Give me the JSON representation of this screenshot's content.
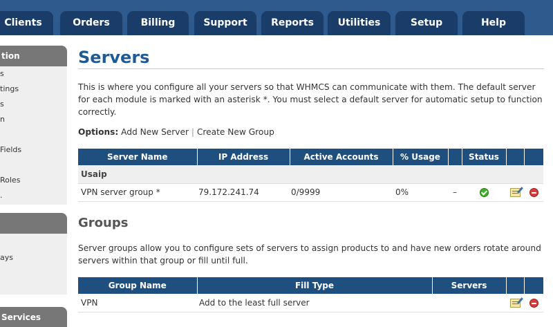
{
  "nav": {
    "tabs": [
      "Clients",
      "Orders",
      "Billing",
      "Support",
      "Reports",
      "Utilities",
      "Setup",
      "Help"
    ]
  },
  "sidebar": {
    "header1": "tion",
    "items1": [
      "s",
      "tings",
      "s",
      "n",
      "Fields",
      "Roles",
      "."
    ],
    "items2": [
      "ays"
    ],
    "header3": "Services"
  },
  "main": {
    "title": "Servers",
    "description": "This is where you configure all your servers so that WHMCS can communicate with them. The default server for each module is marked with an asterisk *. You must select a default server for automatic setup to function correctly.",
    "options_label": "Options:",
    "options_add": "Add New Server",
    "options_sep": "|",
    "options_group": "Create New Group"
  },
  "servers_table": {
    "headers": [
      "Server Name",
      "IP Address",
      "Active Accounts",
      "% Usage",
      "",
      "Status",
      "",
      ""
    ],
    "group_name": "Usaip",
    "row": {
      "name": "VPN server group *",
      "ip": "79.172.241.74",
      "accounts": "0/9999",
      "usage": "0%",
      "dash": "–"
    }
  },
  "groups": {
    "title": "Groups",
    "description": "Server groups allow you to configure sets of servers to assign products to and have new orders rotate around servers within that group or fill until full.",
    "headers": [
      "Group Name",
      "Fill Type",
      "Servers",
      "",
      ""
    ],
    "row": {
      "name": "VPN",
      "fill_type": "Add to the least full server",
      "servers": ""
    }
  },
  "icons": {
    "status": "check-circle-icon",
    "edit": "edit-icon",
    "delete": "delete-icon"
  },
  "colors": {
    "nav_bg": "#2f5a8e",
    "tab_bg": "#1a3c68",
    "title": "#1f5a96",
    "table_header": "#1f4f7f"
  }
}
